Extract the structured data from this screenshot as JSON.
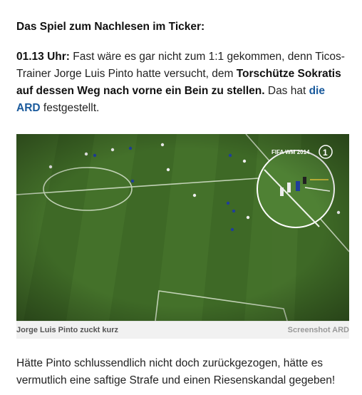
{
  "heading": "Das Spiel zum Nachlesen im Ticker:",
  "ticker": {
    "time": "01.13 Uhr:",
    "text_1": " Fast wäre es gar nicht zum 1:1 gekommen, denn Ticos-Trainer Jorge Luis Pinto hatte versucht, dem ",
    "bold_text": "Torschütze Sokratis auf dessen Weg nach vorne ein Bein zu stellen.",
    "text_2": " Das hat ",
    "link": "die ARD",
    "text_3": " festgestellt."
  },
  "image": {
    "overlay_label": "FIFA WM 2014",
    "overlay_logo": "1",
    "caption": "Jorge Luis Pinto zuckt kurz",
    "credit": "Screenshot ARD",
    "colors": {
      "pitch_dark": "#3b6524",
      "pitch_light": "#4a7a2e",
      "lines": "#dfe8d6"
    }
  },
  "closing": "Hätte Pinto schlussendlich nicht doch zurückgezogen, hätte es vermutlich eine saftige Strafe und einen Riesenskandal gegeben!"
}
